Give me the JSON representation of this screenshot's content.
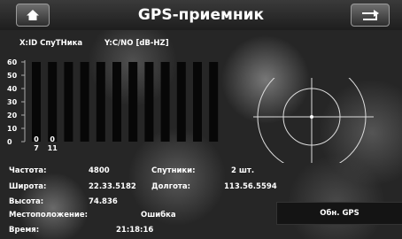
{
  "window": {
    "title": "GPS-приемник"
  },
  "header": {
    "x_label": "X:ID СпуТНика",
    "y_label": "Y:C/NO [dB-HZ]"
  },
  "chart_data": {
    "type": "bar",
    "y_ticks": [
      "60",
      "50",
      "40",
      "30",
      "20",
      "10",
      "0"
    ],
    "ylim": [
      0,
      60
    ],
    "categories": [
      "7",
      "11",
      "",
      "",
      "",
      "",
      "",
      "",
      "",
      "",
      "",
      ""
    ],
    "values": [
      0,
      0,
      0,
      0,
      0,
      0,
      0,
      0,
      0,
      0,
      0,
      0
    ],
    "value_labels": [
      "0",
      "0"
    ]
  },
  "info": {
    "freq_label": "Частота:",
    "freq_value": "4800",
    "sats_label": "Спутники:",
    "sats_value": "2 шт.",
    "lat_label": "Широта:",
    "lat_value": "22.33.5182",
    "lon_label": "Долгота:",
    "lon_value": "113.56.5594",
    "alt_label": "Высота:",
    "alt_value": "74.836",
    "pos_label": "Местоположение:",
    "pos_value": "Ошибка",
    "time_label": "Время:",
    "time_value": "21:18:16"
  },
  "buttons": {
    "refresh_label": "Обн. GPS"
  }
}
